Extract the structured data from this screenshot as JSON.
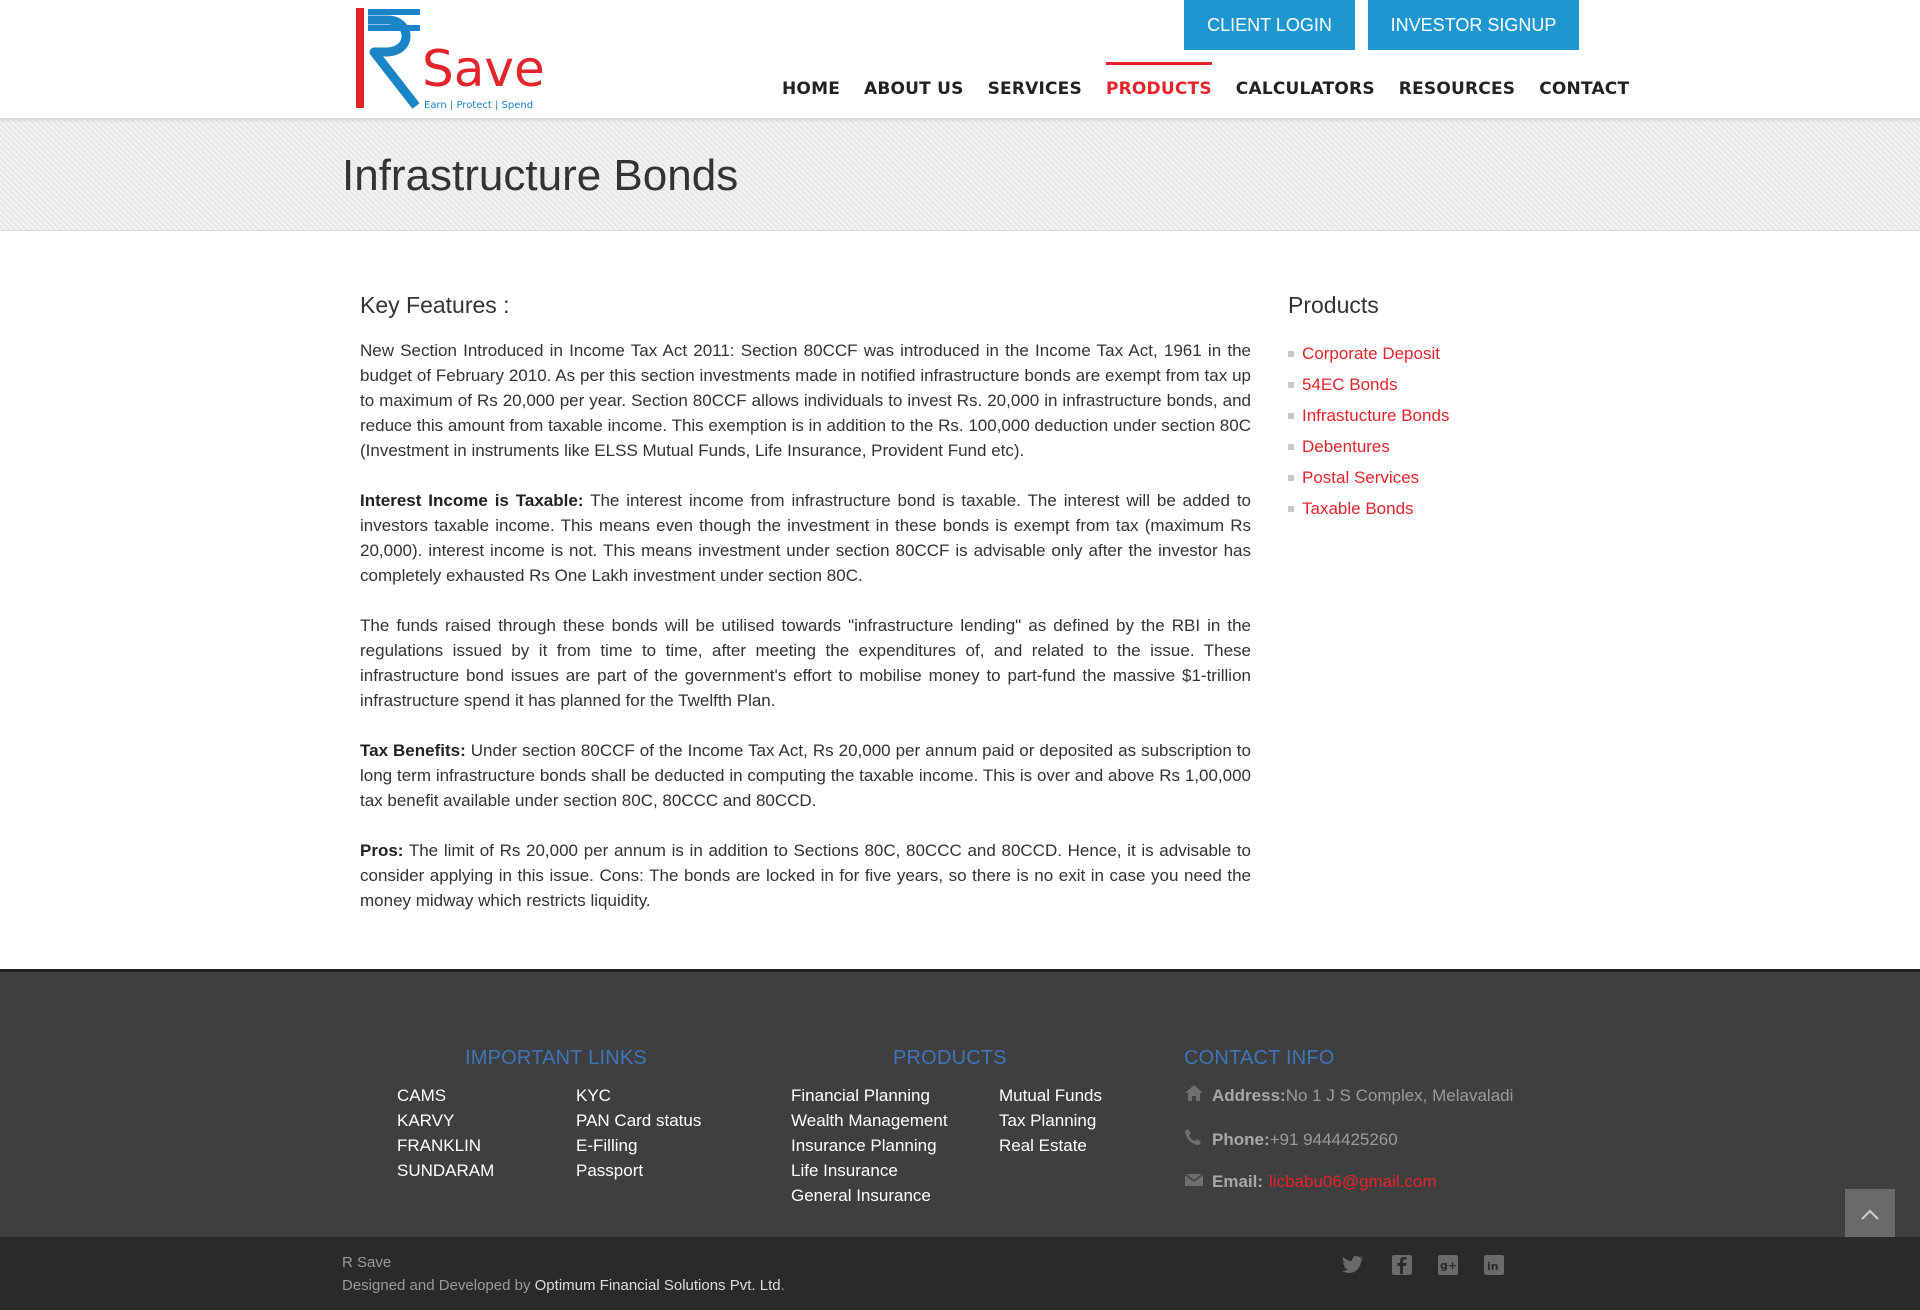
{
  "brand": {
    "name": "Save",
    "tagline": "Earn | Protect | Spend",
    "colors": {
      "red": "#e3242b",
      "blue": "#1e97d1",
      "footer_heading": "#3e75b8"
    }
  },
  "header": {
    "client_login": "CLIENT LOGIN",
    "investor_signup": "INVESTOR SIGNUP",
    "nav": [
      "HOME",
      "ABOUT US",
      "SERVICES",
      "PRODUCTS",
      "CALCULATORS",
      "RESOURCES",
      "CONTACT"
    ],
    "active_nav": "PRODUCTS"
  },
  "page": {
    "title": "Infrastructure Bonds"
  },
  "main": {
    "heading": "Key Features :",
    "p1": "New Section Introduced in Income Tax Act 2011: Section 80CCF was introduced in the Income Tax Act, 1961 in the budget of February 2010. As per this section investments made in notified infrastructure bonds are exempt from tax up to maximum of Rs 20,000 per year. Section 80CCF allows individuals to invest Rs. 20,000 in infrastructure bonds, and reduce this amount from taxable income. This exemption is in addition to the Rs. 100,000 deduction under section 80C (Investment in instruments like ELSS Mutual Funds, Life Insurance, Provident Fund etc).",
    "p2_label": "Interest Income is Taxable:",
    "p2": " The interest income from infrastructure bond is taxable. The interest will be added to investors taxable income. This means even though the investment in these bonds is exempt from tax (maximum Rs 20,000). interest income is not. This means investment under section 80CCF is advisable only after the investor has completely exhausted Rs One Lakh investment under section 80C.",
    "p3": "The funds raised through these bonds will be utilised towards \"infrastructure lending\" as defined by the RBI in the regulations issued by it from time to time, after meeting the expenditures of, and related to the issue. These infrastructure bond issues are part of the government's effort to mobilise money to part-fund the massive $1-trillion infrastructure spend it has planned for the Twelfth Plan.",
    "p4_label": "Tax Benefits:",
    "p4": " Under section 80CCF of the Income Tax Act, Rs 20,000 per annum paid or deposited as subscription to long term infrastructure bonds shall be deducted in computing the taxable income. This is over and above Rs 1,00,000 tax benefit available under section 80C, 80CCC and 80CCD.",
    "p5_label": "Pros:",
    "p5": " The limit of Rs 20,000 per annum is in addition to Sections 80C, 80CCC and 80CCD. Hence, it is advisable to consider applying in this issue. Cons: The bonds are locked in for five years, so there is no exit in case you need the money midway which restricts liquidity."
  },
  "sidebar": {
    "heading": "Products",
    "items": [
      "Corporate Deposit",
      "54EC Bonds",
      "Infrastucture Bonds",
      "Debentures",
      "Postal Services",
      "Taxable Bonds"
    ]
  },
  "footer": {
    "links_title": "IMPORTANT LINKS",
    "links_col1": [
      "CAMS",
      "KARVY",
      "FRANKLIN",
      "SUNDARAM"
    ],
    "links_col2": [
      "KYC",
      "PAN Card status",
      "E-Filling",
      "Passport"
    ],
    "products_title": "PRODUCTS",
    "products_col1": [
      "Financial Planning",
      "Wealth Management",
      "Insurance Planning",
      "Life Insurance",
      "General Insurance"
    ],
    "products_col2": [
      "Mutual Funds",
      "Tax Planning",
      "Real Estate"
    ],
    "contact_title": "CONTACT INFO",
    "address_label": "Address:",
    "address": "No 1 J S Complex, Melavaladi",
    "phone_label": "Phone:",
    "phone": "+91 9444425260",
    "email_label": "Email:",
    "email": "licbabu06@gmail.com"
  },
  "bottom": {
    "site_name": "R Save",
    "designed_by": "Designed and Developed by ",
    "developer": "Optimum Financial Solutions Pvt. Ltd",
    "period": ".",
    "social_icons": [
      "twitter-icon",
      "facebook-icon",
      "google-plus-icon",
      "linkedin-icon"
    ]
  }
}
